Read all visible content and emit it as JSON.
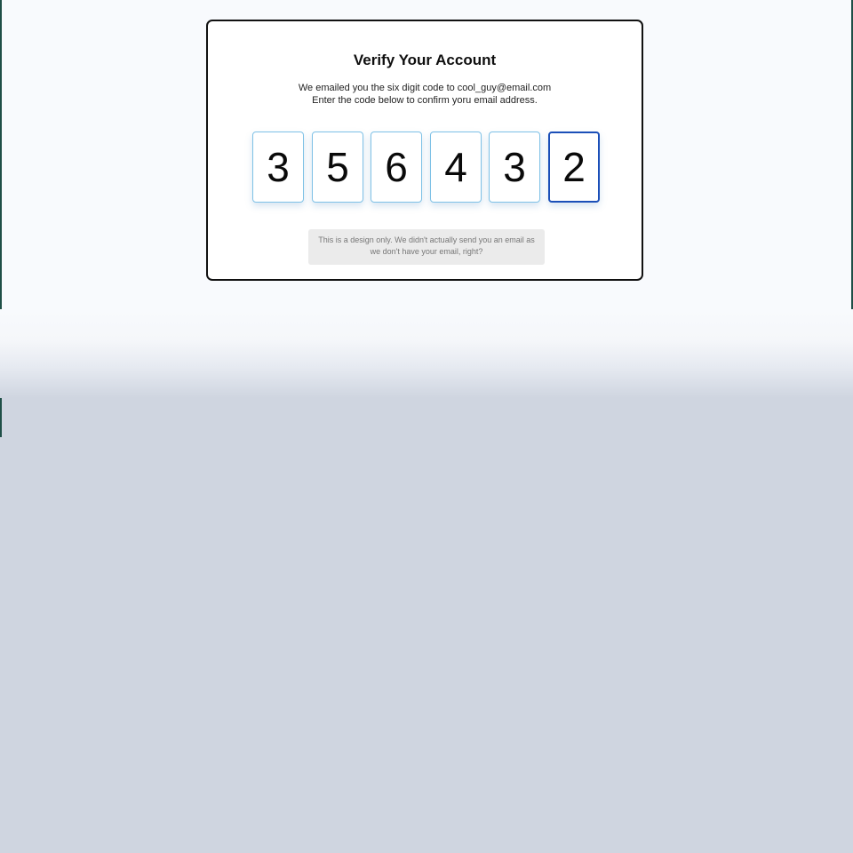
{
  "card": {
    "title": "Verify Your Account",
    "subtitle_line1": "We emailed you the six digit code to cool_guy@email.com",
    "subtitle_line2": "Enter the code below to confirm yoru email address."
  },
  "code": {
    "digits": [
      "3",
      "5",
      "6",
      "4",
      "3",
      "2"
    ],
    "active_index": 5
  },
  "note": {
    "line1": "This is a design only. We didn't actually send you an email as",
    "line2": "we don't have your email, right?"
  },
  "colors": {
    "page_background": "#f8fafd",
    "card_border": "#111111",
    "input_border": "#7ec1e6",
    "input_active_border": "#1b4fb8",
    "note_background": "#ebebeb"
  }
}
